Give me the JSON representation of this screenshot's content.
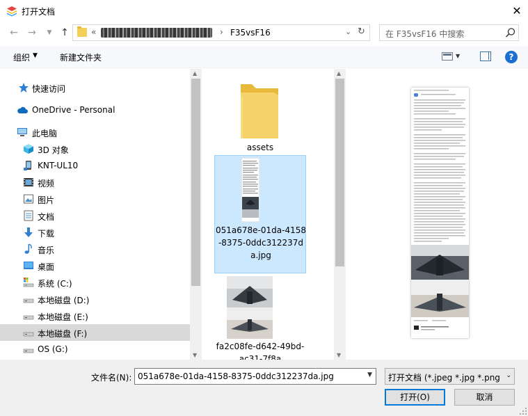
{
  "window": {
    "title": "打开文档"
  },
  "address": {
    "path_hidden_prefix": "«",
    "current_folder": "F35vsF16"
  },
  "search": {
    "placeholder": "在 F35vsF16 中搜索"
  },
  "toolbar": {
    "organize": "组织",
    "new_folder": "新建文件夹"
  },
  "sidebar": {
    "items": [
      {
        "label": "快速访问",
        "icon": "star-icon"
      },
      {
        "label": "OneDrive - Personal",
        "icon": "cloud-icon"
      },
      {
        "label": "此电脑",
        "icon": "computer-icon"
      },
      {
        "label": "3D 对象",
        "icon": "cube-icon"
      },
      {
        "label": "KNT-UL10",
        "icon": "device-icon"
      },
      {
        "label": "视频",
        "icon": "video-icon"
      },
      {
        "label": "图片",
        "icon": "picture-icon"
      },
      {
        "label": "文档",
        "icon": "document-icon"
      },
      {
        "label": "下载",
        "icon": "download-icon"
      },
      {
        "label": "音乐",
        "icon": "music-icon"
      },
      {
        "label": "桌面",
        "icon": "desktop-icon"
      },
      {
        "label": "系统 (C:)",
        "icon": "system-drive-icon"
      },
      {
        "label": "本地磁盘 (D:)",
        "icon": "drive-icon"
      },
      {
        "label": "本地磁盘 (E:)",
        "icon": "drive-icon"
      },
      {
        "label": "本地磁盘 (F:)",
        "icon": "drive-icon",
        "selected": true
      },
      {
        "label": "OS (G:)",
        "icon": "drive-icon"
      }
    ]
  },
  "files": [
    {
      "name": "assets",
      "type": "folder"
    },
    {
      "name": "051a678e-01da-4158-8375-0ddc312237da.jpg",
      "type": "image",
      "selected": true
    },
    {
      "name": "fa2c08fe-d642-49bd-ac31-7f8a",
      "type": "image"
    }
  ],
  "bottom": {
    "filename_label": "文件名(N):",
    "filename_value": "051a678e-01da-4158-8375-0ddc312237da.jpg",
    "filetype_value": "打开文档 (*.jpeg *.jpg *.png *",
    "open_button": "打开(O)",
    "cancel_button": "取消"
  },
  "colors": {
    "accent": "#0078d7",
    "selection": "#cce8ff",
    "sidebar_selected": "#d9d9d9"
  }
}
